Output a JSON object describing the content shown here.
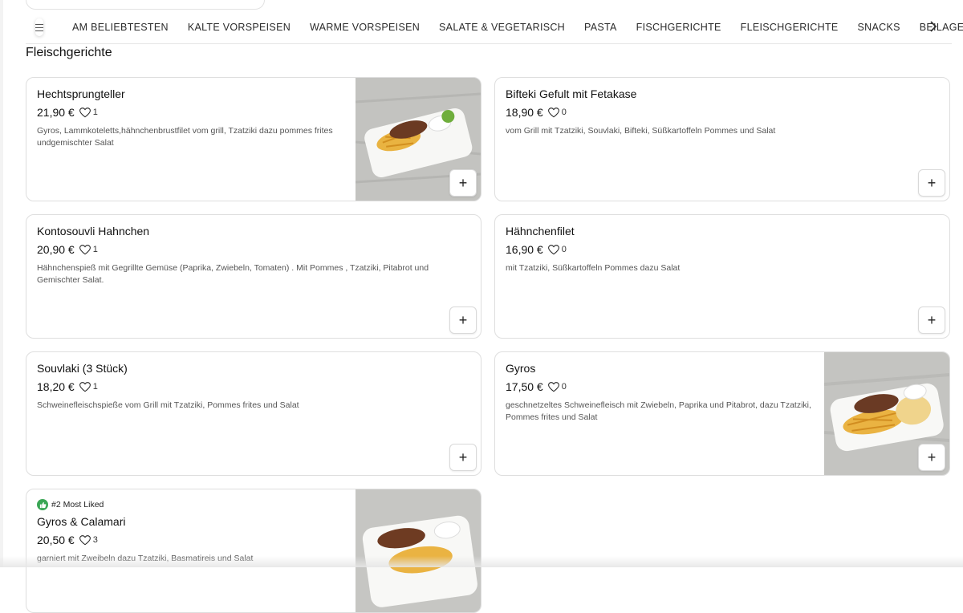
{
  "categories": {
    "items": [
      "AM BELIEBTESTEN",
      "KALTE VORSPEISEN",
      "WARME VORSPEISEN",
      "SALATE & VEGETARISCH",
      "PASTA",
      "FISCHGERICHTE",
      "FLEISCHGERICHTE",
      "SNACKS",
      "BEILAGEN"
    ],
    "next_icon": "chevron-right-icon"
  },
  "section": {
    "title": "Fleischgerichte"
  },
  "dishes": [
    {
      "name": "Hechtsprungteller",
      "price": "21,90 €",
      "likes": "1",
      "description": "Gyros, Lammkoteletts,hähnchenbrustfilet vom grill, Tzatziki dazu pommes frites undgemischter Salat",
      "add": "+"
    },
    {
      "name": "Bifteki Gefult mit Fetakase",
      "price": "18,90 €",
      "likes": "0",
      "description": "vom Grill mit Tzatziki, Souvlaki, Bifteki, Süßkartoffeln Pommes und Salat",
      "add": "+"
    },
    {
      "name": "Kontosouvli Hahnchen",
      "price": "20,90 €",
      "likes": "1",
      "description": "Hähnchenspieß mit Gegrillte Gemüse (Paprika, Zwiebeln, Tomaten) . Mit Pommes , Tzatziki, Pitabrot und Gemischter Salat.",
      "add": "+"
    },
    {
      "name": "Hähnchenfilet",
      "price": "16,90 €",
      "likes": "0",
      "description": "mit Tzatziki, Süßkartoffeln Pommes dazu Salat",
      "add": "+"
    },
    {
      "name": "Souvlaki (3 Stück)",
      "price": "18,20 €",
      "likes": "1",
      "description": "Schweinefleischspieße vom Grill mit Tzatziki, Pommes frites und Salat",
      "add": "+"
    },
    {
      "name": "Gyros",
      "price": "17,50 €",
      "likes": "0",
      "description": "geschnetzeltes Schweinefleisch mit Zwiebeln, Paprika und Pitabrot, dazu Tzatziki, Pommes frites und Salat",
      "add": "+"
    },
    {
      "badge": "#2 Most Liked",
      "name": "Gyros & Calamari",
      "price": "20,50 €",
      "likes": "3",
      "description": "garniert mit Zweibeln dazu Tzatziki, Basmatireis und Salat",
      "add": "+"
    }
  ],
  "colors": {
    "badge_green": "#3aa655",
    "border": "#dedede",
    "text_muted": "#555555"
  }
}
